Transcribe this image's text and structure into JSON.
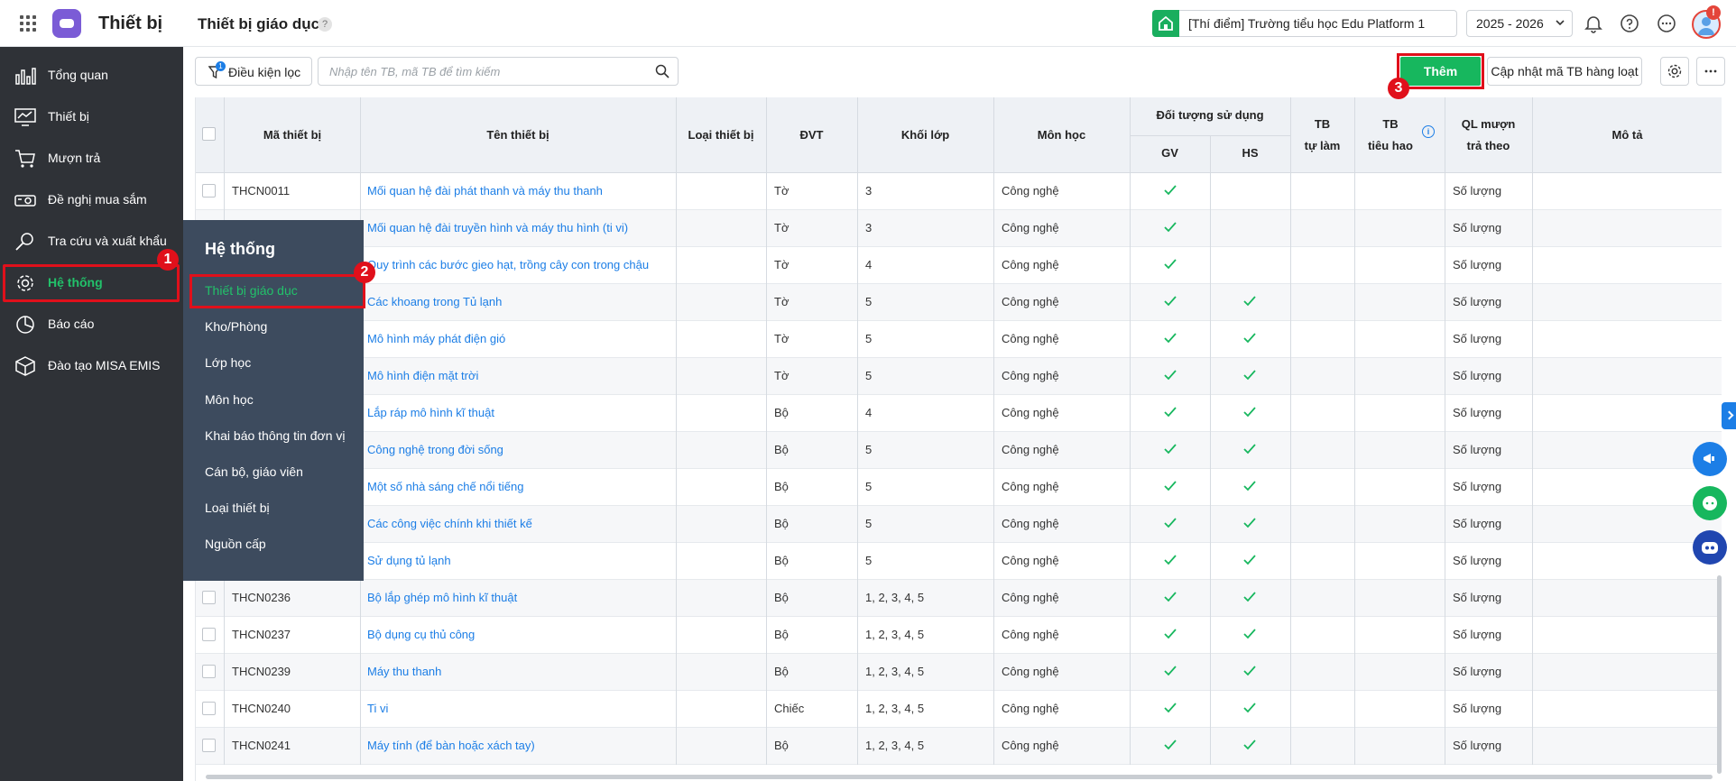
{
  "app": {
    "title": "Thiết bị",
    "page_title": "Thiết bị giáo dục",
    "help_mark": "?"
  },
  "header": {
    "school": "[Thí điểm] Trường tiểu học Edu Platform 1",
    "year": "2025 - 2026",
    "notification_badge": "!"
  },
  "sidebar": {
    "items": [
      {
        "label": "Tổng quan",
        "icon": "chart-icon"
      },
      {
        "label": "Thiết bị",
        "icon": "monitor-icon"
      },
      {
        "label": "Mượn trả",
        "icon": "cart-icon"
      },
      {
        "label": "Đề nghị mua sắm",
        "icon": "projector-icon"
      },
      {
        "label": "Tra cứu và xuất khẩu",
        "icon": "search-icon"
      },
      {
        "label": "Hệ thống",
        "icon": "gear-icon",
        "active": true
      },
      {
        "label": "Báo cáo",
        "icon": "pie-icon"
      },
      {
        "label": "Đào tạo MISA EMIS",
        "icon": "box-icon"
      }
    ]
  },
  "flyout": {
    "title": "Hệ thống",
    "items": [
      "Thiết bị giáo dục",
      "Kho/Phòng",
      "Lớp học",
      "Môn học",
      "Khai báo thông tin đơn vị",
      "Cán bộ, giáo viên",
      "Loại thiết bị",
      "Nguồn cấp"
    ]
  },
  "steps": {
    "one": "1",
    "two": "2",
    "three": "3"
  },
  "toolbar": {
    "filter_label": "Điều kiện lọc",
    "filter_badge": "1",
    "search_placeholder": "Nhập tên TB, mã TB để tìm kiếm",
    "add_label": "Thêm",
    "bulk_label": "Cập nhật mã TB hàng loạt"
  },
  "table": {
    "headers": {
      "code": "Mã thiết bị",
      "name": "Tên thiết bị",
      "type": "Loại thiết bị",
      "unit": "ĐVT",
      "grade": "Khối lớp",
      "subject": "Môn học",
      "users": "Đối tượng sử dụng",
      "gv": "GV",
      "hs": "HS",
      "self_made_1": "TB",
      "self_made_2": "tự làm",
      "consumable_1": "TB",
      "consumable_2": "tiêu hao",
      "borrow_1": "QL mượn",
      "borrow_2": "trả theo",
      "desc": "Mô tả"
    },
    "rows": [
      {
        "code": "THCN0011",
        "name": "Mối quan hệ đài phát thanh và máy thu thanh",
        "unit": "Tờ",
        "grade": "3",
        "subject": "Công nghệ",
        "gv": true,
        "hs": false,
        "borrow": "Số lượng"
      },
      {
        "code": "",
        "name": "Mối quan hệ đài truyền hình và máy thu hình (ti vi)",
        "unit": "Tờ",
        "grade": "3",
        "subject": "Công nghệ",
        "gv": true,
        "hs": false,
        "borrow": "Số lượng"
      },
      {
        "code": "",
        "name": "Quy trình các bước gieo hạt, trồng cây con trong chậu",
        "unit": "Tờ",
        "grade": "4",
        "subject": "Công nghệ",
        "gv": true,
        "hs": false,
        "borrow": "Số lượng"
      },
      {
        "code": "",
        "name": "Các khoang trong Tủ lạnh",
        "unit": "Tờ",
        "grade": "5",
        "subject": "Công nghệ",
        "gv": true,
        "hs": true,
        "borrow": "Số lượng"
      },
      {
        "code": "",
        "name": "Mô hình máy phát điện gió",
        "unit": "Tờ",
        "grade": "5",
        "subject": "Công nghệ",
        "gv": true,
        "hs": true,
        "borrow": "Số lượng"
      },
      {
        "code": "",
        "name": "Mô hình điện mặt trời",
        "unit": "Tờ",
        "grade": "5",
        "subject": "Công nghệ",
        "gv": true,
        "hs": true,
        "borrow": "Số lượng"
      },
      {
        "code": "",
        "name": "Lắp ráp mô hình kĩ thuật",
        "unit": "Bộ",
        "grade": "4",
        "subject": "Công nghệ",
        "gv": true,
        "hs": true,
        "borrow": "Số lượng"
      },
      {
        "code": "",
        "name": "Công nghệ trong đời sống",
        "unit": "Bộ",
        "grade": "5",
        "subject": "Công nghệ",
        "gv": true,
        "hs": true,
        "borrow": "Số lượng"
      },
      {
        "code": "",
        "name": "Một số nhà sáng chế nổi tiếng",
        "unit": "Bộ",
        "grade": "5",
        "subject": "Công nghệ",
        "gv": true,
        "hs": true,
        "borrow": "Số lượng"
      },
      {
        "code": "",
        "name": "Các công việc chính khi thiết kế",
        "unit": "Bộ",
        "grade": "5",
        "subject": "Công nghệ",
        "gv": true,
        "hs": true,
        "borrow": "Số lượng"
      },
      {
        "code": "",
        "name": "Sử dụng tủ lạnh",
        "unit": "Bộ",
        "grade": "5",
        "subject": "Công nghệ",
        "gv": true,
        "hs": true,
        "borrow": "Số lượng"
      },
      {
        "code": "THCN0236",
        "name": "Bộ lắp ghép mô hình kĩ thuật",
        "unit": "Bộ",
        "grade": "1, 2, 3, 4, 5",
        "subject": "Công nghệ",
        "gv": true,
        "hs": true,
        "borrow": "Số lượng"
      },
      {
        "code": "THCN0237",
        "name": "Bộ dụng cụ thủ công",
        "unit": "Bộ",
        "grade": "1, 2, 3, 4, 5",
        "subject": "Công nghệ",
        "gv": true,
        "hs": true,
        "borrow": "Số lượng"
      },
      {
        "code": "THCN0239",
        "name": "Máy thu thanh",
        "unit": "Bộ",
        "grade": "1, 2, 3, 4, 5",
        "subject": "Công nghệ",
        "gv": true,
        "hs": true,
        "borrow": "Số lượng"
      },
      {
        "code": "THCN0240",
        "name": "Ti vi",
        "unit": "Chiếc",
        "grade": "1, 2, 3, 4, 5",
        "subject": "Công nghệ",
        "gv": true,
        "hs": true,
        "borrow": "Số lượng"
      },
      {
        "code": "THCN0241",
        "name": "Máy tính (để bàn hoặc xách tay)",
        "unit": "Bộ",
        "grade": "1, 2, 3, 4, 5",
        "subject": "Công nghệ",
        "gv": true,
        "hs": true,
        "borrow": "Số lượng"
      }
    ]
  },
  "colors": {
    "accent": "#17b75e",
    "link": "#1c7ee6",
    "highlight": "#e0101b",
    "sidebar": "#2f3237",
    "flyout": "#3d4b5e"
  }
}
